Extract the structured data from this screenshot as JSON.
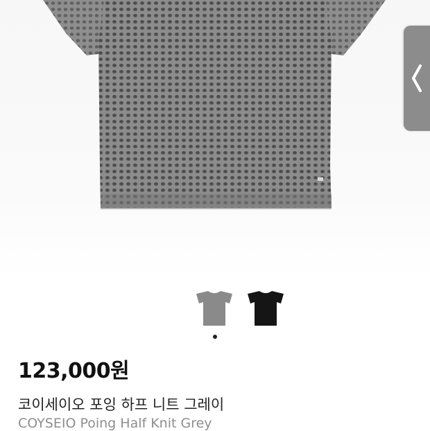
{
  "gallery": {
    "main_image": "grey-knit-tshirt",
    "thumbnails": [
      {
        "name": "grey-knit-thumbnail",
        "color": "#8a8a8a"
      },
      {
        "name": "black-knit-thumbnail",
        "color": "#151515"
      }
    ],
    "active_index": 0,
    "side_tab_icon": "chevron-left-icon"
  },
  "product": {
    "price": "123,000원",
    "title_ko": "코이세이오 포잉 하프 니트 그레이",
    "title_en": "COYSEIO Poing Half Knit Grey"
  },
  "colors": {
    "knit_grey": "#8a8a8a",
    "knit_black": "#151515",
    "side_tab": "#8c8c8c"
  }
}
